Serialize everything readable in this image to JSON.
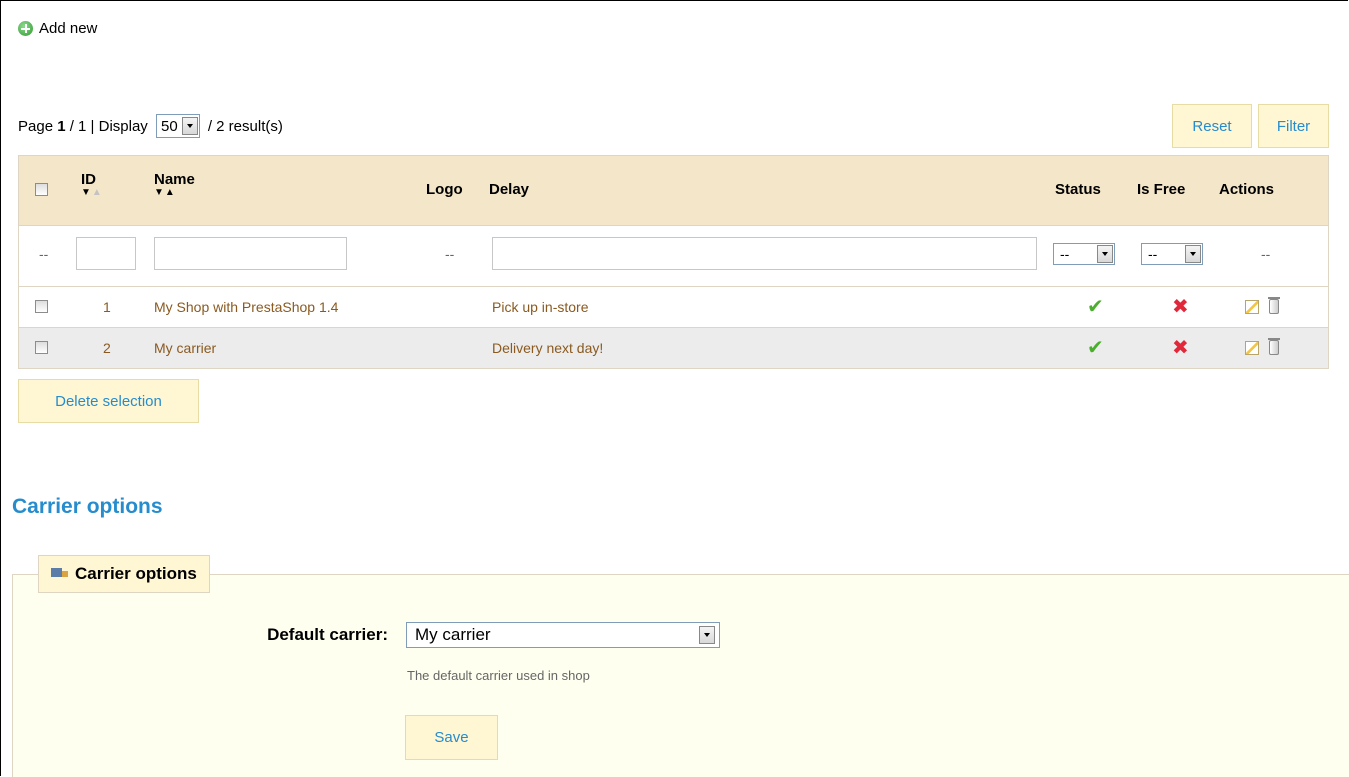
{
  "toolbar": {
    "add_new_label": "Add new"
  },
  "pagination": {
    "page_prefix": "Page ",
    "current_page": "1",
    "page_suffix": " / 1 | Display ",
    "per_page": "50",
    "results_text": " / 2 result(s)"
  },
  "buttons": {
    "reset": "Reset",
    "filter": "Filter",
    "delete_selection": "Delete selection",
    "save": "Save"
  },
  "table": {
    "columns": {
      "id": "ID",
      "name": "Name",
      "logo": "Logo",
      "delay": "Delay",
      "status": "Status",
      "is_free": "Is Free",
      "actions": "Actions"
    },
    "filter_placeholder": "--",
    "rows": [
      {
        "id": "1",
        "name": "My Shop with PrestaShop 1.4",
        "delay": "Pick up in-store",
        "status": "check-icon",
        "is_free": "x-icon"
      },
      {
        "id": "2",
        "name": "My carrier",
        "delay": "Delivery next day!",
        "status": "check-icon",
        "is_free": "x-icon"
      }
    ]
  },
  "carrier_options": {
    "section_title": "Carrier options",
    "legend": "Carrier options",
    "default_carrier_label": "Default carrier:",
    "default_carrier_value": "My carrier",
    "hint": "The default carrier used in shop"
  },
  "colors": {
    "accent_blue": "#268ccd",
    "header_bg": "#f4e6c9",
    "button_bg": "#fff6d3",
    "fieldset_bg": "#fffff0"
  }
}
